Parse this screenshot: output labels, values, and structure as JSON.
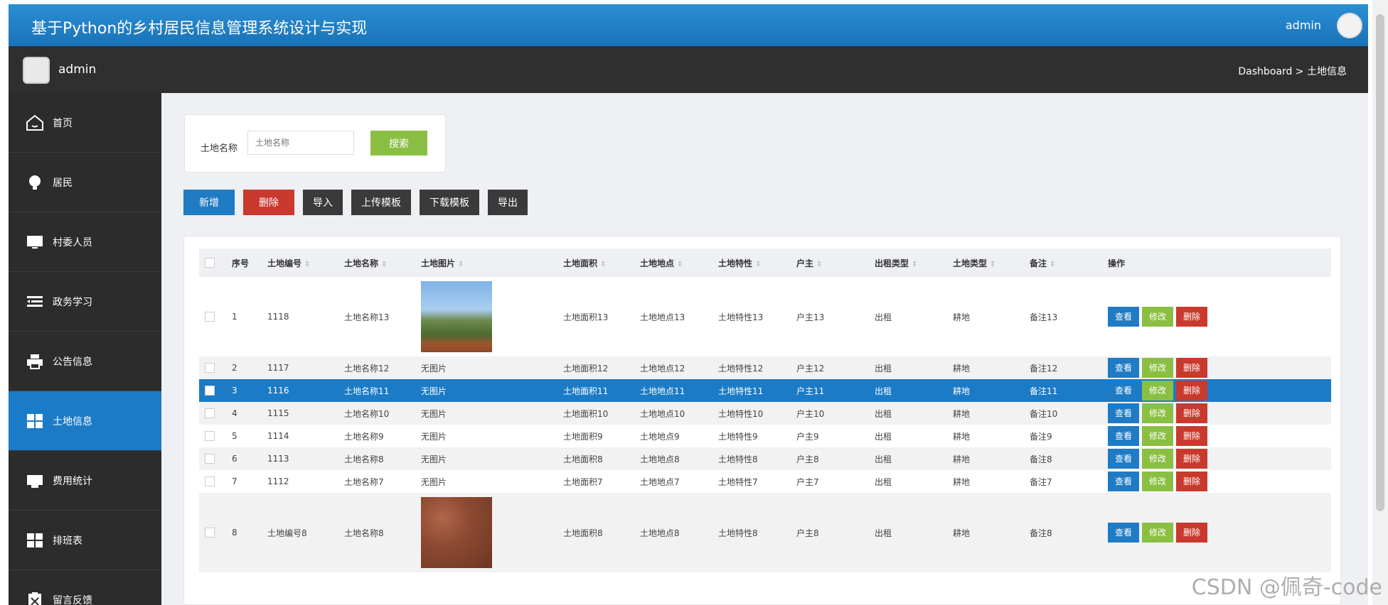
{
  "header": {
    "title": "基于Python的乡村居民信息管理系统设计与实现",
    "user": "admin"
  },
  "subbar": {
    "user": "admin",
    "breadcrumb": "Dashboard > 土地信息"
  },
  "sidebar": {
    "items": [
      {
        "label": "首页",
        "icon": "home-icon"
      },
      {
        "label": "居民",
        "icon": "bulb-icon"
      },
      {
        "label": "村委人员",
        "icon": "monitor-icon"
      },
      {
        "label": "政务学习",
        "icon": "list-icon"
      },
      {
        "label": "公告信息",
        "icon": "print-icon"
      },
      {
        "label": "土地信息",
        "icon": "grid-icon",
        "active": true
      },
      {
        "label": "费用统计",
        "icon": "tray-icon"
      },
      {
        "label": "排班表",
        "icon": "grid-icon"
      },
      {
        "label": "留言反馈",
        "icon": "clipboard-x-icon"
      }
    ]
  },
  "search": {
    "label": "土地名称",
    "placeholder": "土地名称",
    "button": "搜索"
  },
  "toolbar": {
    "add": "新增",
    "delete": "删除",
    "import": "导入",
    "upload": "上传模板",
    "download": "下载模板",
    "export": "导出"
  },
  "table": {
    "headers": [
      "序号",
      "土地编号",
      "土地名称",
      "土地图片",
      "土地面积",
      "土地地点",
      "土地特性",
      "户主",
      "出租类型",
      "土地类型",
      "备注",
      "操作"
    ],
    "actions": {
      "view": "查看",
      "edit": "修改",
      "delete": "删除"
    },
    "rows": [
      {
        "no": "1",
        "code": "1118",
        "name": "土地名称13",
        "image": "landscape",
        "area": "土地面积13",
        "place": "土地地点13",
        "feature": "土地特性13",
        "owner": "户主13",
        "rent": "出租",
        "type": "耕地",
        "note": "备注13"
      },
      {
        "no": "2",
        "code": "1117",
        "name": "土地名称12",
        "image": "无图片",
        "area": "土地面积12",
        "place": "土地地点12",
        "feature": "土地特性12",
        "owner": "户主12",
        "rent": "出租",
        "type": "耕地",
        "note": "备注12"
      },
      {
        "no": "3",
        "code": "1116",
        "name": "土地名称11",
        "image": "无图片",
        "area": "土地面积11",
        "place": "土地地点11",
        "feature": "土地特性11",
        "owner": "户主11",
        "rent": "出租",
        "type": "耕地",
        "note": "备注11"
      },
      {
        "no": "4",
        "code": "1115",
        "name": "土地名称10",
        "image": "无图片",
        "area": "土地面积10",
        "place": "土地地点10",
        "feature": "土地特性10",
        "owner": "户主10",
        "rent": "出租",
        "type": "耕地",
        "note": "备注10"
      },
      {
        "no": "5",
        "code": "1114",
        "name": "土地名称9",
        "image": "无图片",
        "area": "土地面积9",
        "place": "土地地点9",
        "feature": "土地特性9",
        "owner": "户主9",
        "rent": "出租",
        "type": "耕地",
        "note": "备注9"
      },
      {
        "no": "6",
        "code": "1113",
        "name": "土地名称8",
        "image": "无图片",
        "area": "土地面积8",
        "place": "土地地点8",
        "feature": "土地特性8",
        "owner": "户主8",
        "rent": "出租",
        "type": "耕地",
        "note": "备注8"
      },
      {
        "no": "7",
        "code": "1112",
        "name": "土地名称7",
        "image": "无图片",
        "area": "土地面积7",
        "place": "土地地点7",
        "feature": "土地特性7",
        "owner": "户主7",
        "rent": "出租",
        "type": "耕地",
        "note": "备注7"
      },
      {
        "no": "8",
        "code": "土地编号8",
        "name": "土地名称8",
        "image": "soil",
        "area": "土地面积8",
        "place": "土地地点8",
        "feature": "土地特性8",
        "owner": "户主8",
        "rent": "出租",
        "type": "耕地",
        "note": "备注8"
      }
    ]
  },
  "watermark": "CSDN @佩奇-code"
}
